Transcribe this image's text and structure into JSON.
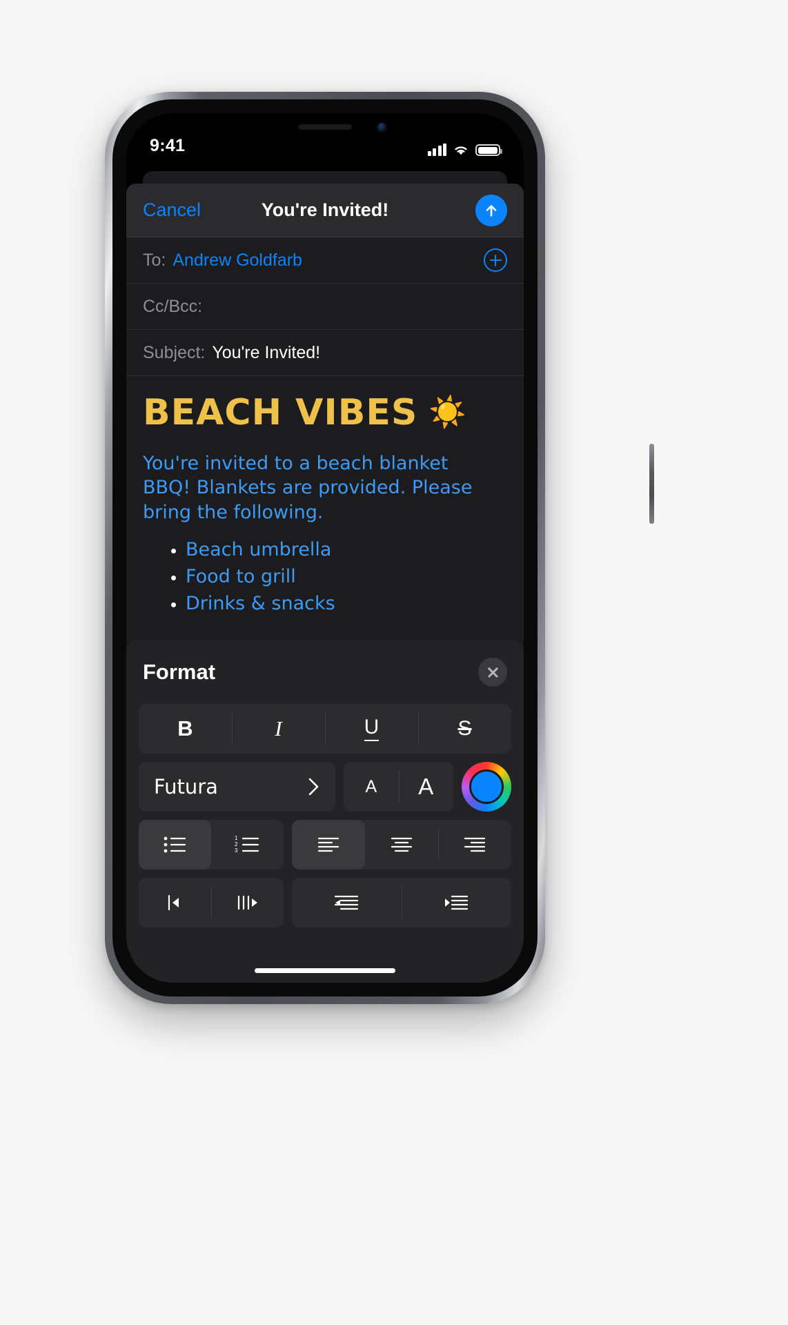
{
  "status_bar": {
    "time": "9:41",
    "signal_icon": "cellular-signal-icon",
    "wifi_icon": "wifi-icon",
    "battery_icon": "battery-icon",
    "battery_level_percent": 92
  },
  "compose": {
    "cancel_label": "Cancel",
    "title": "You're Invited!",
    "send_icon": "send-arrow-up-icon",
    "fields": [
      {
        "label": "To:",
        "value": "Andrew Goldfarb",
        "style": "blue"
      },
      {
        "label": "Cc/Bcc:",
        "value": "",
        "style": "blue"
      },
      {
        "label": "Subject:",
        "value": "You're Invited!",
        "style": "white"
      }
    ],
    "add_recipient_icon": "add-contact-plus-icon"
  },
  "body": {
    "heading": "BEACH VIBES",
    "heading_emoji": "☀️",
    "paragraph": "You're invited to a beach blanket BBQ! Blankets are provided. Please bring the following.",
    "list": [
      "Beach umbrella",
      "Food to grill",
      "Drinks & snacks"
    ]
  },
  "format_panel": {
    "title": "Format",
    "close_icon": "close-x-icon",
    "style_row": [
      {
        "name": "bold-button",
        "label": "B",
        "glyph_class": "glyph-b",
        "selected": false
      },
      {
        "name": "italic-button",
        "label": "I",
        "glyph_class": "glyph-i",
        "selected": false
      },
      {
        "name": "underline-button",
        "label": "U",
        "glyph_class": "glyph-u",
        "selected": false
      },
      {
        "name": "strikethrough-button",
        "label": "S",
        "glyph_class": "glyph-s",
        "selected": false
      }
    ],
    "font_picker": {
      "font_name": "Futura",
      "chevron_icon": "chevron-right-icon"
    },
    "size_row": [
      {
        "name": "decrease-font-size-button",
        "label": "A",
        "glyph_class": "glyph-a-small"
      },
      {
        "name": "increase-font-size-button",
        "label": "A",
        "glyph_class": "glyph-a-large"
      }
    ],
    "color_wheel_icon": "color-wheel-button",
    "color_wheel_selected_color": "#0a84ff",
    "list_row": [
      {
        "name": "bulleted-list-button",
        "icon": "bulleted-list-icon",
        "selected": true
      },
      {
        "name": "numbered-list-button",
        "icon": "numbered-list-icon",
        "selected": false
      }
    ],
    "align_row": [
      {
        "name": "align-left-button",
        "icon": "align-left-icon",
        "selected": true
      },
      {
        "name": "align-center-button",
        "icon": "align-center-icon",
        "selected": false
      },
      {
        "name": "align-right-button",
        "icon": "align-right-icon",
        "selected": false
      }
    ],
    "direction_row": [
      {
        "name": "text-direction-rtl-button",
        "icon": "text-direction-left-icon",
        "selected": false
      },
      {
        "name": "text-direction-ltr-button",
        "icon": "text-direction-right-icon",
        "selected": false
      }
    ],
    "indent_row": [
      {
        "name": "decrease-indent-button",
        "icon": "decrease-indent-icon",
        "selected": false
      },
      {
        "name": "increase-indent-button",
        "icon": "increase-indent-icon",
        "selected": false
      }
    ]
  },
  "home_indicator": "home-indicator"
}
